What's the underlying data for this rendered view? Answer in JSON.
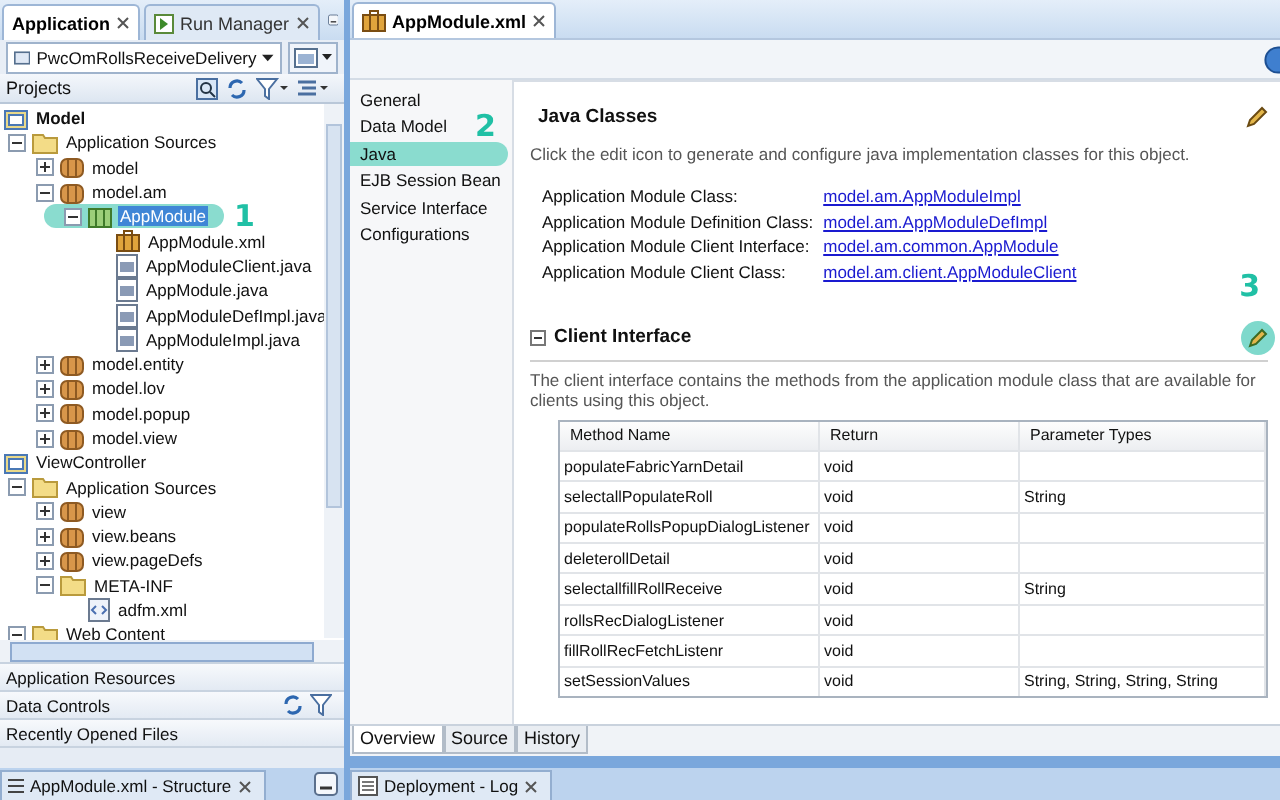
{
  "left_panel": {
    "tabs": [
      {
        "label": "Application",
        "selected": true
      },
      {
        "label": "Run Manager",
        "selected": false
      }
    ],
    "application": "PwcOmRollsReceiveDelivery",
    "projects_label": "Projects",
    "tree": [
      {
        "label": "Model",
        "kind": "project",
        "active": true,
        "selected": false,
        "children": [
          {
            "label": "Application Sources",
            "kind": "folder",
            "expanded": true,
            "selected": false,
            "children": [
              {
                "label": "model",
                "kind": "package",
                "expanded": false,
                "selected": false
              },
              {
                "label": "model.am",
                "kind": "package",
                "expanded": true,
                "selected": false,
                "children": [
                  {
                    "label": "AppModule",
                    "kind": "appmodule",
                    "expanded": true,
                    "selected": true,
                    "callout": "1",
                    "children": [
                      {
                        "label": "AppModule.xml",
                        "kind": "xml",
                        "selected": false
                      },
                      {
                        "label": "AppModuleClient.java",
                        "kind": "java",
                        "selected": false
                      },
                      {
                        "label": "AppModule.java",
                        "kind": "java",
                        "selected": false
                      },
                      {
                        "label": "AppModuleDefImpl.java",
                        "kind": "java",
                        "selected": false
                      },
                      {
                        "label": "AppModuleImpl.java",
                        "kind": "java",
                        "selected": false
                      }
                    ]
                  }
                ]
              },
              {
                "label": "model.entity",
                "kind": "package",
                "expanded": false,
                "selected": false
              },
              {
                "label": "model.lov",
                "kind": "package",
                "expanded": false,
                "selected": false
              },
              {
                "label": "model.popup",
                "kind": "package",
                "expanded": false,
                "selected": false
              },
              {
                "label": "model.view",
                "kind": "package",
                "expanded": false,
                "selected": false
              }
            ]
          }
        ]
      },
      {
        "label": "ViewController",
        "kind": "project",
        "active": false,
        "selected": false,
        "children": [
          {
            "label": "Application Sources",
            "kind": "folder",
            "expanded": true,
            "selected": false,
            "children": [
              {
                "label": "view",
                "kind": "package",
                "expanded": false,
                "selected": false
              },
              {
                "label": "view.beans",
                "kind": "package",
                "expanded": false,
                "selected": false
              },
              {
                "label": "view.pageDefs",
                "kind": "package",
                "expanded": false,
                "selected": false
              },
              {
                "label": "META-INF",
                "kind": "folder",
                "expanded": true,
                "selected": false,
                "children": [
                  {
                    "label": "adfm.xml",
                    "kind": "xmlfile",
                    "selected": false
                  }
                ]
              }
            ]
          },
          {
            "label": "Web Content",
            "kind": "folder",
            "expanded": true,
            "selected": false
          }
        ]
      }
    ],
    "accordion": [
      {
        "label": "Application Resources",
        "has_tools": false
      },
      {
        "label": "Data Controls",
        "has_tools": true
      },
      {
        "label": "Recently Opened Files",
        "has_tools": false
      }
    ],
    "bottom_tab": "AppModule.xml - Structure"
  },
  "editor": {
    "tabs": [
      {
        "label": "AppModule.xml",
        "selected": true
      }
    ],
    "nav": [
      {
        "label": "General",
        "selected": false
      },
      {
        "label": "Data Model",
        "selected": false,
        "callout": "2"
      },
      {
        "label": "Java",
        "selected": true
      },
      {
        "label": "EJB Session Bean",
        "selected": false
      },
      {
        "label": "Service Interface",
        "selected": false
      },
      {
        "label": "Configurations",
        "selected": false
      }
    ],
    "java_classes": {
      "title": "Java Classes",
      "description": "Click the edit icon to generate and configure java implementation classes for this object.",
      "rows": [
        {
          "label": "Application Module Class:",
          "value": "model.am.AppModuleImpl"
        },
        {
          "label": "Application Module Definition Class:",
          "value": "model.am.AppModuleDefImpl"
        },
        {
          "label": "Application Module Client Interface:",
          "value": "model.am.common.AppModule"
        },
        {
          "label": "Application Module Client Class:",
          "value": "model.am.client.AppModuleClient"
        }
      ]
    },
    "client_interface": {
      "title": "Client Interface",
      "expanded": true,
      "callout": "3",
      "description": "The client interface contains the methods from the application module class that are available for clients using this object.",
      "columns": [
        "Method Name",
        "Return",
        "Parameter Types"
      ],
      "rows": [
        [
          "populateFabricYarnDetail",
          "void",
          ""
        ],
        [
          "selectallPopulateRoll",
          "void",
          "String"
        ],
        [
          "populateRollsPopupDialogListener",
          "void",
          ""
        ],
        [
          "deleterollDetail",
          "void",
          ""
        ],
        [
          "selectallfillRollReceive",
          "void",
          "String"
        ],
        [
          "rollsRecDialogListener",
          "void",
          ""
        ],
        [
          "fillRollRecFetchListenr",
          "void",
          ""
        ],
        [
          "setSessionValues",
          "void",
          "String, String, String, String"
        ]
      ]
    },
    "bottom_tabs": [
      {
        "label": "Overview",
        "selected": true
      },
      {
        "label": "Source",
        "selected": false
      },
      {
        "label": "History",
        "selected": false
      }
    ],
    "log_tab": "Deployment - Log"
  }
}
